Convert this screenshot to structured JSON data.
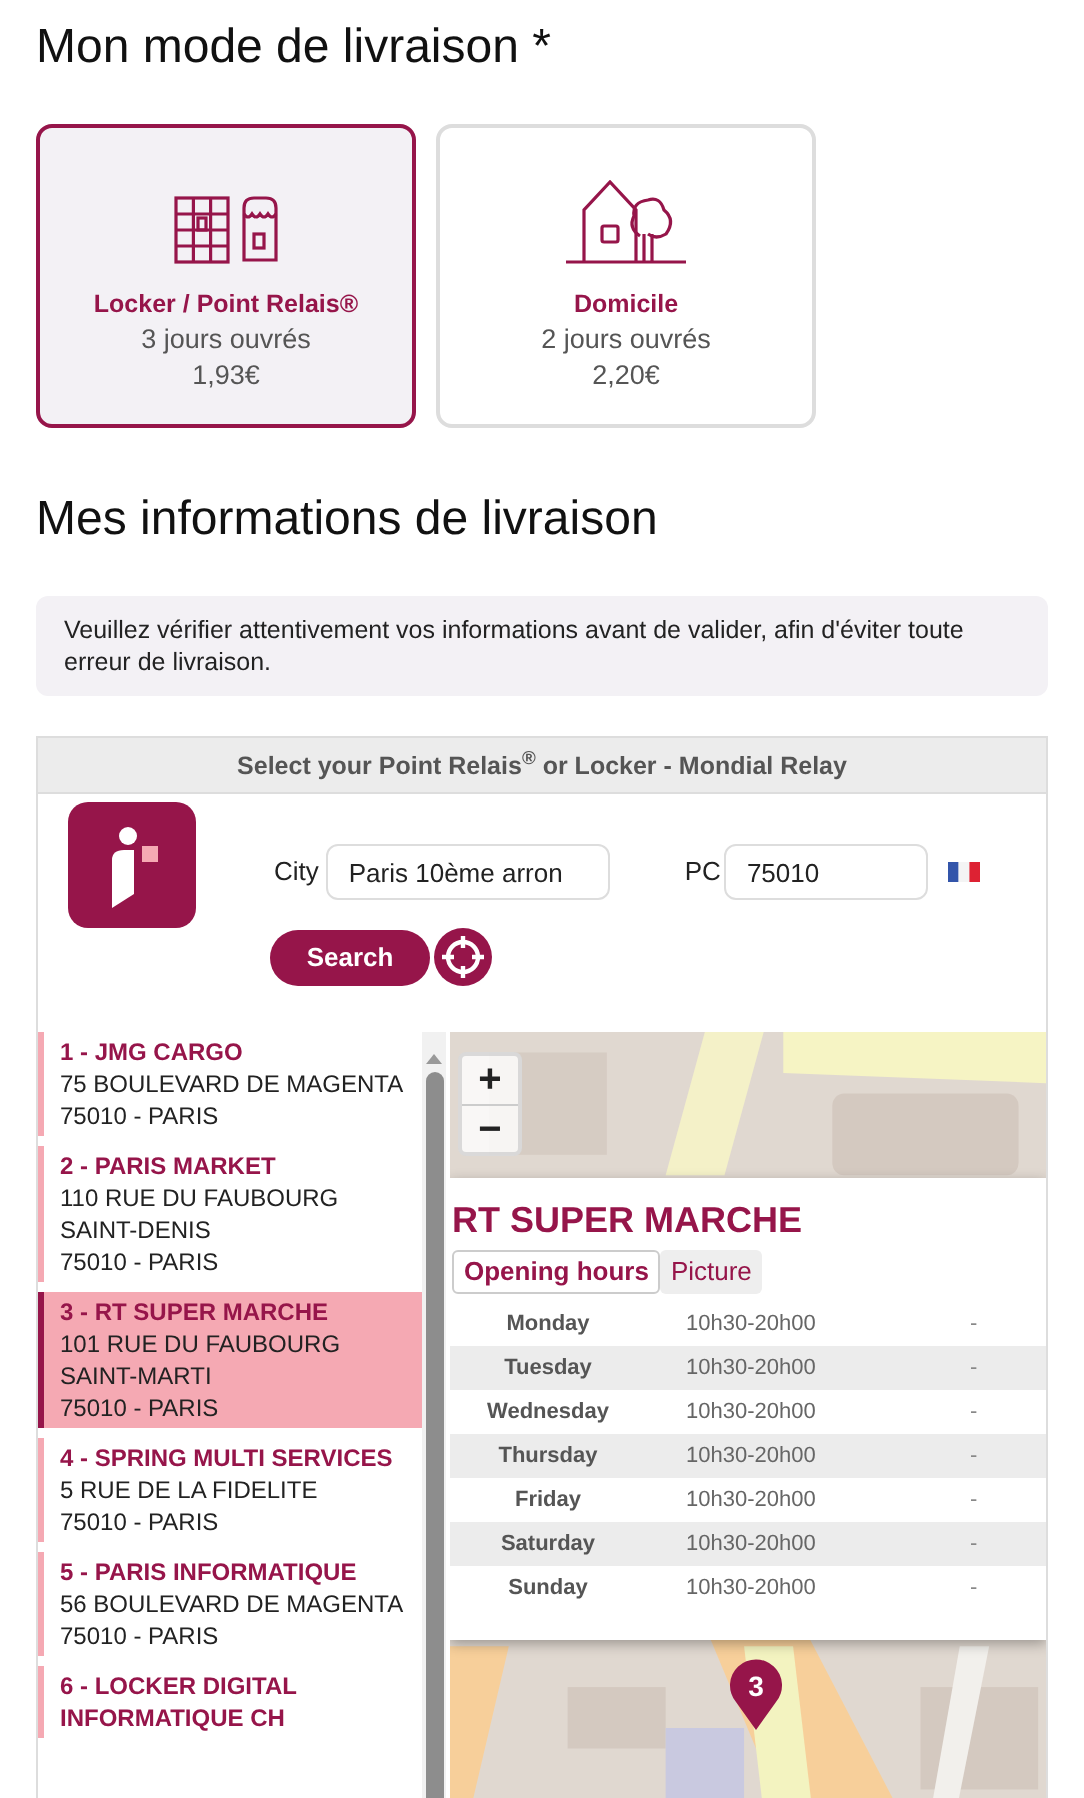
{
  "delivery_mode": {
    "title": "Mon mode de livraison *",
    "options": [
      {
        "kind": "locker",
        "label": "Locker / Point Relais®",
        "delay": "3 jours ouvrés",
        "price": "1,93€",
        "selected": true
      },
      {
        "kind": "home",
        "label": "Domicile",
        "delay": "2 jours ouvrés",
        "price": "2,20€",
        "selected": false
      }
    ]
  },
  "delivery_info": {
    "title": "Mes informations de livraison",
    "notice": "Veuillez vérifier attentivement vos informations avant de valider, afin d'éviter toute erreur de livraison."
  },
  "relay_widget": {
    "header": "Select your Point Relais$^{®}$ or Locker - Mondial Relay",
    "city": {
      "label": "City",
      "value": "Paris 10ème arron"
    },
    "postcode": {
      "label": "PC",
      "value": "75010"
    },
    "search_button": "Search",
    "points": [
      {
        "name": "1 - JMG CARGO",
        "address": [
          "75 BOULEVARD DE MAGENTA",
          "75010 - PARIS"
        ],
        "selected": false
      },
      {
        "name": "2 - PARIS MARKET",
        "address": [
          "110 RUE DU FAUBOURG SAINT-DENIS",
          "75010 - PARIS"
        ],
        "selected": false
      },
      {
        "name": "3 - RT SUPER MARCHE",
        "address": [
          "101 RUE DU FAUBOURG SAINT-MARTI",
          "75010 - PARIS"
        ],
        "selected": true
      },
      {
        "name": "4 - SPRING MULTI SERVICES",
        "address": [
          "5 RUE DE LA FIDELITE",
          "75010 - PARIS"
        ],
        "selected": false
      },
      {
        "name": "5 - PARIS INFORMATIQUE",
        "address": [
          "56 BOULEVARD DE MAGENTA",
          "75010 - PARIS"
        ],
        "selected": false
      },
      {
        "name": "6 - LOCKER DIGITAL INFORMATIQUE CH",
        "selected": false
      }
    ],
    "map": {
      "zoom_in": "+",
      "zoom_out": "−",
      "marker": "3",
      "popup": {
        "title": "RT SUPER MARCHE",
        "tabs": [
          {
            "label": "Opening hours",
            "selected": true
          },
          {
            "label": "Picture",
            "selected": false
          }
        ],
        "hours": [
          {
            "day": "Monday",
            "hours": "10h30-20h00",
            "note": "-"
          },
          {
            "day": "Tuesday",
            "hours": "10h30-20h00",
            "note": "-"
          },
          {
            "day": "Wednesday",
            "hours": "10h30-20h00",
            "note": "-"
          },
          {
            "day": "Thursday",
            "hours": "10h30-20h00",
            "note": "-"
          },
          {
            "day": "Friday",
            "hours": "10h30-20h00",
            "note": "-"
          },
          {
            "day": "Saturday",
            "hours": "10h30-20h00",
            "note": "-"
          },
          {
            "day": "Sunday",
            "hours": "10h30-20h00",
            "note": "-"
          }
        ]
      }
    }
  }
}
